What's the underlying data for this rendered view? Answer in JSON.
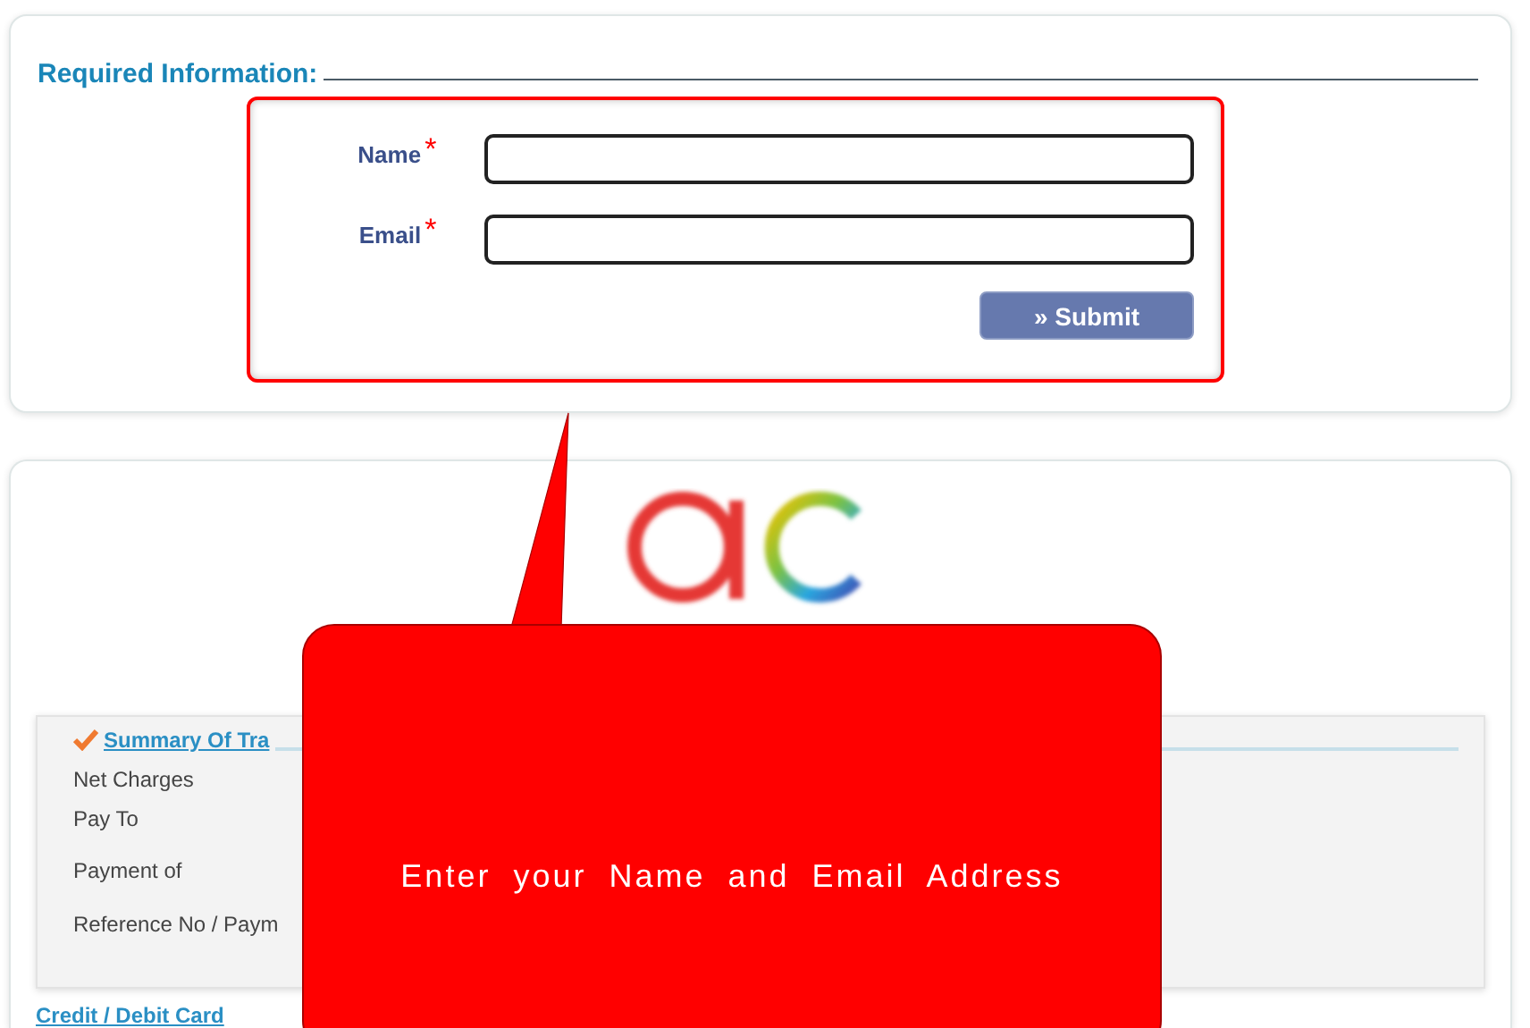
{
  "required_section": {
    "legend": "Required Information:",
    "fields": [
      {
        "label": "Name",
        "required_mark": "*"
      },
      {
        "label": "Email",
        "required_mark": "*"
      }
    ],
    "submit_button": "» Submit"
  },
  "summary_section": {
    "title": "Summary Of Tra",
    "rows": [
      "Net Charges",
      "Pay To",
      "Payment of",
      "Reference No / Paym"
    ],
    "next_heading": "Credit / Debit Card"
  },
  "callout": {
    "text": "Enter your Name and Email Address"
  }
}
